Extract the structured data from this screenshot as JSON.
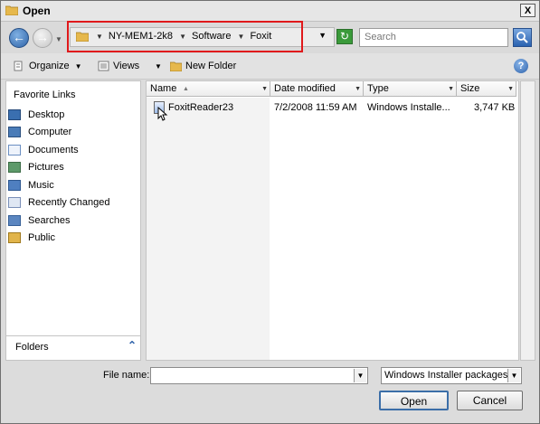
{
  "window": {
    "title": "Open",
    "close_label": "X"
  },
  "nav": {
    "breadcrumbs": [
      "NY-MEM1-2k8",
      "Software",
      "Foxit"
    ],
    "search_placeholder": "Search"
  },
  "toolbar": {
    "organize_label": "Organize",
    "views_label": "Views",
    "new_folder_label": "New Folder",
    "help_label": "?"
  },
  "sidebar": {
    "title": "Favorite Links",
    "items": [
      {
        "label": "Desktop",
        "icon": "desktop-icon",
        "color": "#3a6fb0"
      },
      {
        "label": "Computer",
        "icon": "computer-icon",
        "color": "#4a7cb8"
      },
      {
        "label": "Documents",
        "icon": "documents-icon",
        "color": "#6b8fc2"
      },
      {
        "label": "Pictures",
        "icon": "pictures-icon",
        "color": "#5d9a6a"
      },
      {
        "label": "Music",
        "icon": "music-icon",
        "color": "#4f7fc0"
      },
      {
        "label": "Recently Changed",
        "icon": "recently-changed-icon",
        "color": "#7a8fb8"
      },
      {
        "label": "Searches",
        "icon": "searches-icon",
        "color": "#5b86c0"
      },
      {
        "label": "Public",
        "icon": "public-icon",
        "color": "#e1b44a"
      }
    ],
    "folders_label": "Folders"
  },
  "columns": {
    "name": "Name",
    "date": "Date modified",
    "type": "Type",
    "size": "Size"
  },
  "files": [
    {
      "name": "FoxitReader23",
      "date": "7/2/2008 11:59 AM",
      "type": "Windows Installe...",
      "size": "3,747 KB"
    }
  ],
  "bottom": {
    "filename_label": "File name:",
    "filename_value": "",
    "filter_value": "Windows Installer packages (",
    "open_label": "Open",
    "cancel_label": "Cancel"
  },
  "colors": {
    "highlight_border": "#e0191b",
    "accent_blue": "#2e62aa"
  }
}
